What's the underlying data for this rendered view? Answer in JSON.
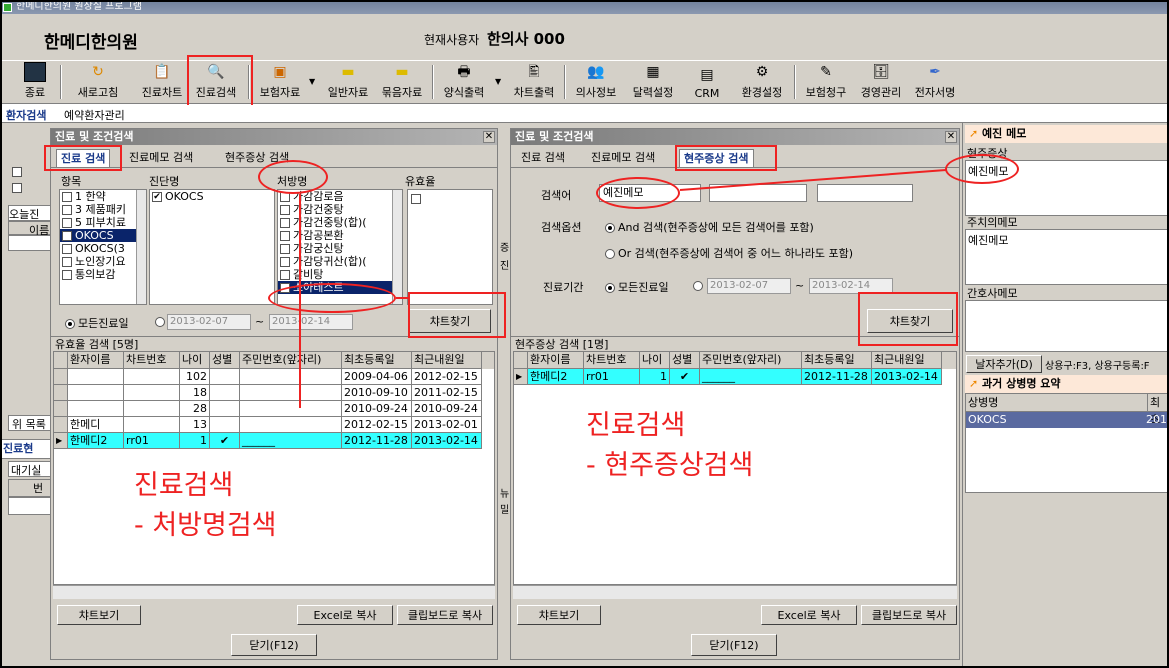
{
  "window_title": "한메디한의원 원장실 프로그램",
  "clinic_name": "한메디한의원",
  "current_user_label": "현재사용자",
  "current_user": "한의사 000",
  "toolbar": [
    "종료",
    "새로고침",
    "진료차트",
    "진료검색",
    "보험자료",
    "일반자료",
    "묶음자료",
    "양식출력",
    "차트출력",
    "의사정보",
    "달력설정",
    "CRM",
    "환경설정",
    "보험청구",
    "경영관리",
    "전자서명"
  ],
  "toolbar_icons": [
    "exit-icon",
    "refresh-icon",
    "chart-icon",
    "search-icon",
    "insurance-icon",
    "folder-icon",
    "folder-icon",
    "print-icon",
    "chart-print-icon",
    "doctor-icon",
    "calendar-icon",
    "crm-icon",
    "settings-icon",
    "claim-icon",
    "management-icon",
    "signature-icon"
  ],
  "main_tabs": [
    "환자검색",
    "예약환자관리"
  ],
  "left_dialog": {
    "title": "진료 및 조건검색",
    "tabs": [
      "진료 검색",
      "진료메모 검색",
      "현주증상 검색"
    ],
    "col_labels": [
      "항목",
      "진단명",
      "처방명",
      "유효율"
    ],
    "items": [
      {
        "text": "1 한약",
        "checked": false
      },
      {
        "text": "3 제품패키",
        "checked": false
      },
      {
        "text": "5 피부치료",
        "checked": false
      },
      {
        "text": "OKOCS",
        "checked": true,
        "selected": true
      },
      {
        "text": "OKOCS(3",
        "checked": false
      },
      {
        "text": "노인장기요",
        "checked": false
      },
      {
        "text": "통의보감",
        "checked": false
      }
    ],
    "diagnosis": [
      {
        "text": "OKOCS",
        "checked": true
      }
    ],
    "prescriptions": [
      {
        "text": "가감감로음",
        "checked": false
      },
      {
        "text": "가감건중탕",
        "checked": false
      },
      {
        "text": "가감건중탕(합)(",
        "checked": false
      },
      {
        "text": "가감공본환",
        "checked": false
      },
      {
        "text": "가감궁신탕",
        "checked": false
      },
      {
        "text": "가감당귀산(합)(",
        "checked": false
      },
      {
        "text": "갈비탕",
        "checked": false
      },
      {
        "text": "소아테스트",
        "checked": true,
        "selected": true
      }
    ],
    "radio_label": "모든진료일",
    "date_from": "2013-02-07",
    "date_to": "2013-02-14",
    "search_button": "챠트찾기",
    "result_title": "유효율 검색 [5명]",
    "columns": [
      "환자이름",
      "차트번호",
      "나이",
      "성별",
      "주민번호(앞자리)",
      "최초등록일",
      "최근내원일"
    ],
    "rows": [
      [
        "",
        "",
        "102",
        "",
        "",
        "2009-04-06",
        "2012-02-15"
      ],
      [
        "",
        "",
        "18",
        "",
        "",
        "2010-09-10",
        "2011-02-15"
      ],
      [
        "",
        "",
        "28",
        "",
        "",
        "2010-09-24",
        "2010-09-24"
      ],
      [
        "한메디",
        "",
        "13",
        "",
        "",
        "2012-02-15",
        "2013-02-01"
      ],
      [
        "한메디2",
        "rr01",
        "1",
        "✔",
        "______",
        "2012-11-28",
        "2013-02-14"
      ]
    ],
    "buttons": [
      "챠트보기",
      "Excel로 복사",
      "클립보드로 복사",
      "닫기(F12)"
    ]
  },
  "right_dialog": {
    "title": "진료 및 조건검색",
    "tabs": [
      "진료 검색",
      "진료메모 검색",
      "현주증상 검색"
    ],
    "keyword_label": "검색어",
    "keyword_value": "예진메모",
    "option_label": "검색옵션",
    "option_and": "And 검색(현주증상에 모든 검색어를 포함)",
    "option_or": "Or 검색(현주증상에 검색어 중 어느 하나라도 포함)",
    "period_label": "진료기간",
    "radio_label": "모든진료일",
    "date_from": "2013-02-07",
    "date_to": "2013-02-14",
    "search_button": "챠트찾기",
    "result_title": "현주증상 검색 [1명]",
    "columns": [
      "환자이름",
      "차트번호",
      "나이",
      "성별",
      "주민번호(앞자리)",
      "최초등록일",
      "최근내원일"
    ],
    "rows": [
      [
        "한메디2",
        "rr01",
        "1",
        "✔",
        "______",
        "2012-11-28",
        "2013-02-14"
      ]
    ],
    "buttons": [
      "챠트보기",
      "Excel로 복사",
      "클립보드로 복사",
      "닫기(F12)"
    ]
  },
  "side_panel": {
    "title": "예진 메모",
    "s1": "현주증상",
    "v1": "예진메모",
    "s2": "주치의메모",
    "v2": "예진메모",
    "s3": "간호사메모",
    "date_button": "날자추가(D)",
    "hint": "상용구:F3, 상용구등록:F",
    "past_title": "과거 상병명 요약",
    "past_col1": "상병명",
    "past_col2": "최초",
    "past_row1": "OKOCS",
    "past_row2": "201"
  },
  "bg_fragments": [
    "오늘진",
    "이름",
    "위 목록",
    "진료현",
    "대기실",
    "번",
    "증",
    "진",
    "뉴",
    "밀"
  ],
  "annotations": {
    "left_line1": "진료검색",
    "left_line2": "- 처방명검색",
    "right_line1": "진료검색",
    "right_line2": "- 현주증상검색"
  }
}
